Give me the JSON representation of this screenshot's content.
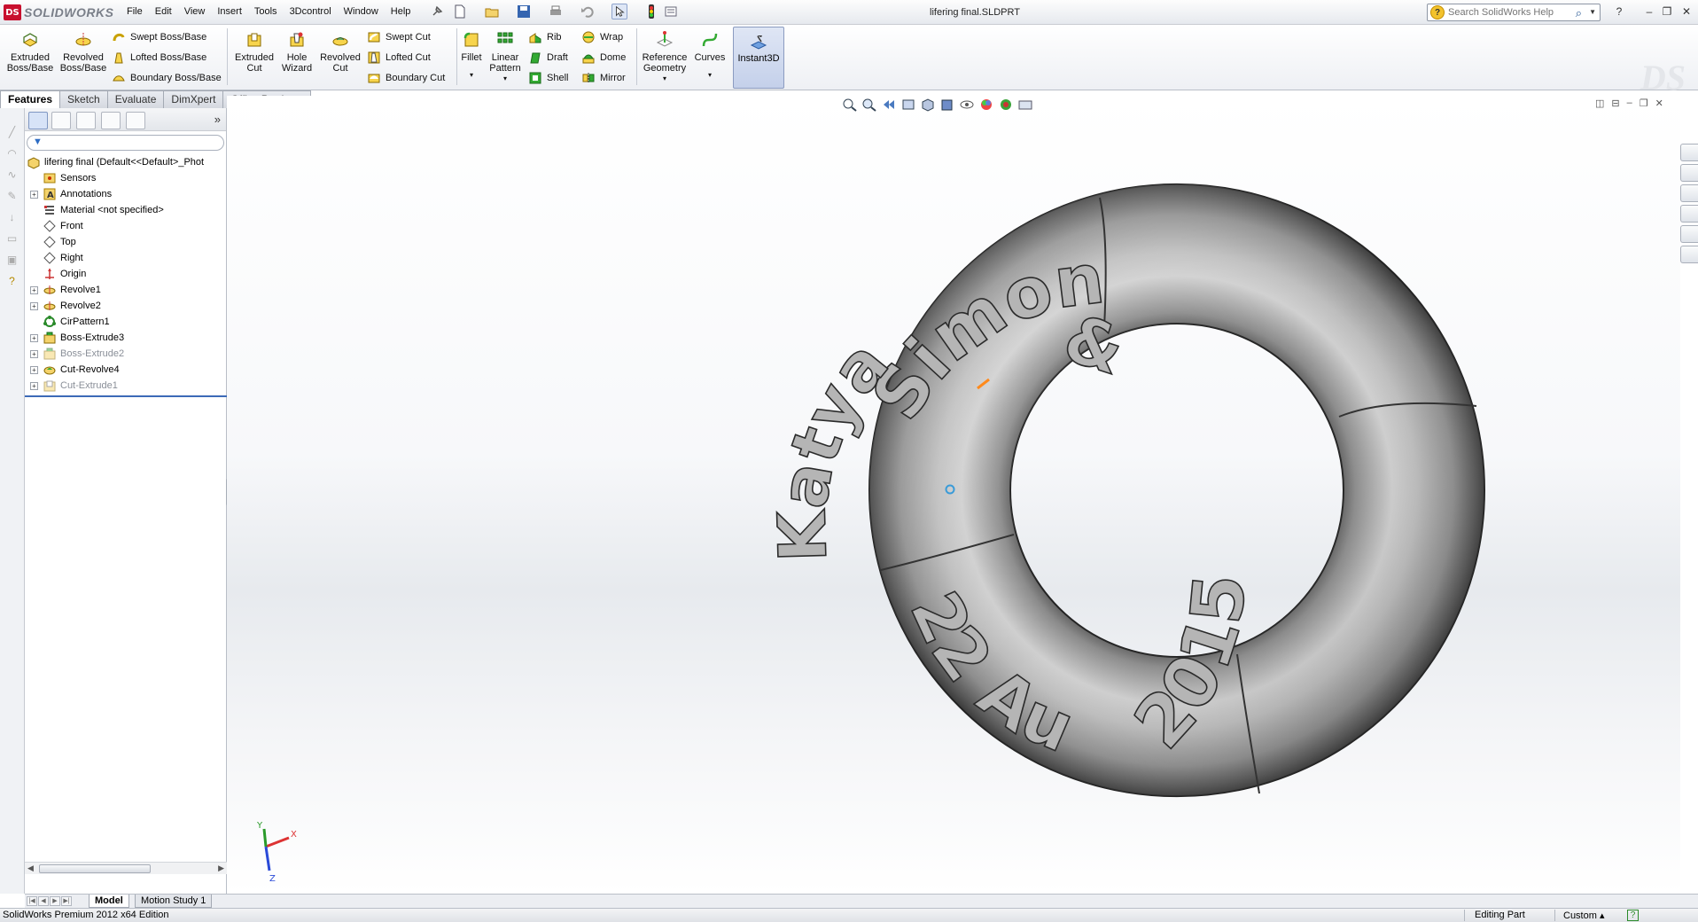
{
  "app": {
    "brand": "SOLIDWORKS",
    "logo_letters": "DS",
    "doc_title": "lifering final.SLDPRT"
  },
  "menu": [
    "File",
    "Edit",
    "View",
    "Insert",
    "Tools",
    "3Dcontrol",
    "Window",
    "Help"
  ],
  "help_search": {
    "placeholder": "Search SolidWorks Help"
  },
  "ribbon": {
    "extruded_boss": "Extruded\nBoss/Base",
    "revolved_boss": "Revolved\nBoss/Base",
    "swept_boss": "Swept Boss/Base",
    "lofted_boss": "Lofted Boss/Base",
    "boundary_boss": "Boundary Boss/Base",
    "extruded_cut": "Extruded\nCut",
    "hole_wizard": "Hole\nWizard",
    "revolved_cut": "Revolved\nCut",
    "swept_cut": "Swept Cut",
    "lofted_cut": "Lofted Cut",
    "boundary_cut": "Boundary Cut",
    "fillet": "Fillet",
    "linear_pattern": "Linear\nPattern",
    "rib": "Rib",
    "draft": "Draft",
    "shell": "Shell",
    "wrap": "Wrap",
    "dome": "Dome",
    "mirror": "Mirror",
    "reference_geometry": "Reference\nGeometry",
    "curves": "Curves",
    "instant3d": "Instant3D"
  },
  "tabs": [
    "Features",
    "Sketch",
    "Evaluate",
    "DimXpert",
    "Office Products"
  ],
  "tree": {
    "root": "lifering final  (Default<<Default>_Phot",
    "items": [
      {
        "label": "Sensors",
        "exp": false,
        "icon": "sensor-icon",
        "suppressed": false
      },
      {
        "label": "Annotations",
        "exp": true,
        "icon": "annotation-icon",
        "suppressed": false
      },
      {
        "label": "Material <not specified>",
        "exp": false,
        "icon": "material-icon",
        "suppressed": false
      },
      {
        "label": "Front",
        "exp": false,
        "icon": "plane-icon",
        "suppressed": false
      },
      {
        "label": "Top",
        "exp": false,
        "icon": "plane-icon",
        "suppressed": false
      },
      {
        "label": "Right",
        "exp": false,
        "icon": "plane-icon",
        "suppressed": false
      },
      {
        "label": "Origin",
        "exp": false,
        "icon": "origin-icon",
        "suppressed": false
      },
      {
        "label": "Revolve1",
        "exp": true,
        "icon": "revolve-icon",
        "suppressed": false
      },
      {
        "label": "Revolve2",
        "exp": true,
        "icon": "revolve-icon",
        "suppressed": false
      },
      {
        "label": "CirPattern1",
        "exp": false,
        "icon": "circular-pattern-icon",
        "suppressed": false
      },
      {
        "label": "Boss-Extrude3",
        "exp": true,
        "icon": "extrude-icon",
        "suppressed": false
      },
      {
        "label": "Boss-Extrude2",
        "exp": true,
        "icon": "extrude-icon",
        "suppressed": true
      },
      {
        "label": "Cut-Revolve4",
        "exp": true,
        "icon": "cut-revolve-icon",
        "suppressed": false
      },
      {
        "label": "Cut-Extrude1",
        "exp": true,
        "icon": "cut-extrude-icon",
        "suppressed": true
      }
    ]
  },
  "bottom_tabs": [
    "Model",
    "Motion Study 1"
  ],
  "status": {
    "edition": "SolidWorks Premium 2012 x64 Edition",
    "mode": "Editing Part",
    "units": "Custom"
  },
  "model": {
    "text_top": "Simon",
    "text_left": "Katya",
    "text_amp": "&",
    "text_bottom": "22 Aug",
    "text_right": "2015"
  },
  "triad": {
    "x": "X",
    "y": "Y",
    "z": "Z"
  },
  "colors": {
    "accent": "#3c6ab7",
    "ring_body": "#a8a8a8",
    "ring_highlight": "#e2e2e2",
    "ring_shadow": "#5e5e5e"
  }
}
